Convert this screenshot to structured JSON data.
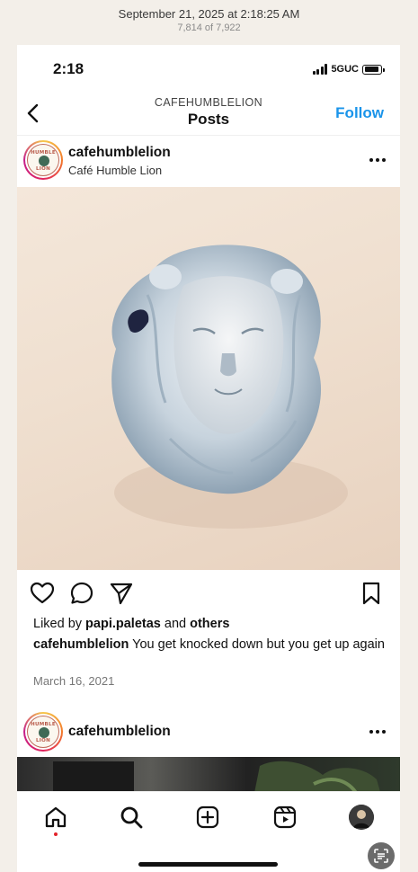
{
  "photos_header": {
    "date": "September 21, 2025 at 2:18:25 AM",
    "count": "7,814 of 7,922"
  },
  "status_bar": {
    "time": "2:18",
    "network": "5GUC"
  },
  "nav": {
    "kicker": "CAFEHUMBLELION",
    "title": "Posts",
    "follow_label": "Follow"
  },
  "avatar_logo": {
    "top": "HUMBLE",
    "bottom": "LION"
  },
  "post": {
    "username": "cafehumblelion",
    "subtitle": "Café Humble Lion",
    "likes": {
      "prefix": "Liked by",
      "user": "papi.paletas",
      "middle": "and",
      "suffix": "others"
    },
    "caption": {
      "user": "cafehumblelion",
      "text": "You get knocked down but you get up again"
    },
    "date": "March 16, 2021"
  },
  "next_post": {
    "username": "cafehumblelion"
  },
  "tabbar": {
    "items": [
      {
        "icon": "home-icon",
        "active": true
      },
      {
        "icon": "search-icon"
      },
      {
        "icon": "create-icon"
      },
      {
        "icon": "reels-icon"
      },
      {
        "icon": "profile-avatar"
      }
    ],
    "notification_color": "#e2232a"
  },
  "colors": {
    "accent": "#1a94ea"
  }
}
